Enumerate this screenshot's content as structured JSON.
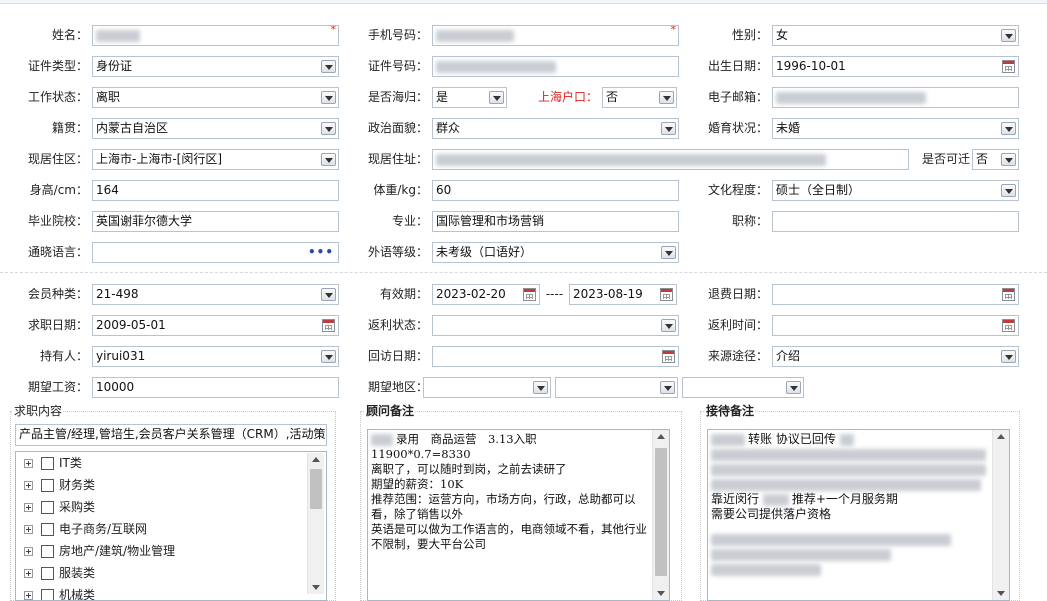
{
  "basic": {
    "name_label": "姓名：",
    "mobile_label": "手机号码：",
    "gender_label": "性别：",
    "gender_value": "女",
    "id_type_label": "证件类型：",
    "id_type_value": "身份证",
    "id_no_label": "证件号码：",
    "birth_label": "出生日期：",
    "birth_value": "1996-10-01",
    "work_status_label": "工作状态：",
    "work_status_value": "离职",
    "returnee_label": "是否海归：",
    "returnee_value": "是",
    "shanghai_hukou_label": "上海户口：",
    "shanghai_hukou_value": "否",
    "email_label": "电子邮箱：",
    "native_label": "籍贯：",
    "native_value": "内蒙古自治区",
    "political_label": "政治面貌：",
    "political_value": "群众",
    "marital_label": "婚育状况：",
    "marital_value": "未婚",
    "residence_area_label": "现居住区：",
    "residence_area_value": "上海市-上海市-[闵行区]",
    "residence_addr_label": "现居住址：",
    "relocate_label": "是否可迁",
    "relocate_value": "否",
    "height_label": "身高/cm：",
    "height_value": "164",
    "weight_label": "体重/kg：",
    "weight_value": "60",
    "education_label": "文化程度：",
    "education_value": "硕士（全日制）",
    "school_label": "毕业院校：",
    "school_value": "英国谢菲尔德大学",
    "major_label": "专业：",
    "major_value": "国际管理和市场营销",
    "title_label": "职称：",
    "language_label": "通晓语言：",
    "language_btn": "•••",
    "foreign_level_label": "外语等级：",
    "foreign_level_value": "未考级（口语好）"
  },
  "member": {
    "type_label": "会员种类：",
    "type_value": "21-498",
    "validity_label": "有效期：",
    "valid_from": "2023-02-20",
    "valid_sep": "----",
    "valid_to": "2023-08-19",
    "refund_date_label": "退费日期：",
    "job_date_label": "求职日期：",
    "job_date_value": "2009-05-01",
    "rebate_status_label": "返利状态：",
    "rebate_time_label": "返利时间：",
    "holder_label": "持有人：",
    "holder_value": "yirui031",
    "callback_label": "回访日期：",
    "source_label": "来源途径：",
    "source_value": "介绍",
    "salary_label": "期望工资：",
    "salary_value": "10000",
    "region_label": "期望地区："
  },
  "job_content": {
    "title": "求职内容",
    "summary": "产品主管/经理,管培生,会员客户关系管理（CRM）,活动策",
    "tree": [
      "IT类",
      "财务类",
      "采购类",
      "电子商务/互联网",
      "房地产/建筑/物业管理",
      "服装类",
      "机械类"
    ]
  },
  "advisor_notes": {
    "title": "顾问备注",
    "lines": [
      "录用　商品运营　3.13入职",
      "11900*0.7=8330",
      "",
      "",
      "",
      "离职了，可以随时到岗，之前去读研了",
      "期望的薪资：10K",
      "推荐范围：运营方向，市场方向，行政，总助都可以看，除了销售以外",
      "英语是可以做为工作语言的，电商领域不看，其他行业不限制，要大平台公司"
    ]
  },
  "reception_notes": {
    "title": "接待备注",
    "line1": "转账 协议已回传",
    "line2": "靠近闵行",
    "line2b": "推荐+一个月服务期",
    "line3": "需要公司提供落户资格"
  },
  "colors": {
    "accent_red": "#e02020",
    "border": "#b7c3d0"
  }
}
